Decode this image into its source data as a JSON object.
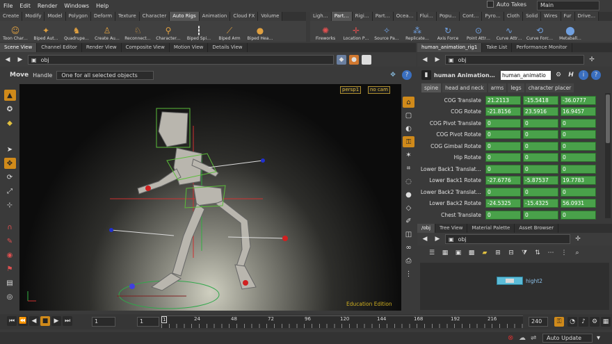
{
  "menu": [
    "File",
    "Edit",
    "Render",
    "Windows",
    "Help"
  ],
  "auto_takes": "Auto Takes",
  "take": "Main",
  "shelf_left_tabs": [
    "Create",
    "Modify",
    "Model",
    "Polygon",
    "Deform",
    "Texture",
    "Character",
    "Auto Rigs",
    "Animation",
    "Cloud FX",
    "Volume"
  ],
  "shelf_right_tabs": [
    "Ligh…",
    "Part…",
    "Rigi…",
    "Part…",
    "Ocea…",
    "Flui…",
    "Popu…",
    "Cont…",
    "Pyro…",
    "Cloth",
    "Solid",
    "Wires",
    "Fur",
    "Drive…"
  ],
  "shelf_left_tools": [
    "Toon Char…",
    "Biped Aut…",
    "Quadrupe…",
    "Create Au…",
    "Reconnect…",
    "Character…",
    "Biped Spi…",
    "Biped Arm",
    "Biped Hea…"
  ],
  "shelf_right_tools": [
    "Fireworks",
    "Location P…",
    "Source Pa…",
    "Replicate…",
    "Axis Force",
    "Point Attr…",
    "Curve Attr…",
    "Curve Forc…",
    "Metaball…"
  ],
  "left_tabs": [
    "Scene View",
    "Channel Editor",
    "Render View",
    "Composite View",
    "Motion View",
    "Details View"
  ],
  "right_tabs": [
    "human_animation_rig1",
    "Take List",
    "Performance Monitor"
  ],
  "path": "obj",
  "op": {
    "name": "Move",
    "handle": "Handle",
    "mode": "One for all selected objects"
  },
  "viewport": {
    "camera": "persp1",
    "cam_menu": "no cam",
    "watermark": "Education Edition"
  },
  "params": {
    "title": "human Animation…",
    "node": "human_animatio",
    "tabs": [
      "spine",
      "head and neck",
      "arms",
      "legs",
      "character placer"
    ],
    "rows": [
      {
        "label": "COG Translate",
        "v": [
          "21.2113",
          "-15.5418",
          "-36.0777"
        ]
      },
      {
        "label": "COG Rotate",
        "v": [
          "-21.8156",
          "23.5916",
          "16.9457"
        ]
      },
      {
        "label": "COG Pivot Translate",
        "v": [
          "0",
          "0",
          "0"
        ]
      },
      {
        "label": "COG Pivot Rotate",
        "v": [
          "0",
          "0",
          "0"
        ]
      },
      {
        "label": "COG Gimbal Rotate",
        "v": [
          "0",
          "0",
          "0"
        ]
      },
      {
        "label": "Hip Rotate",
        "v": [
          "0",
          "0",
          "0"
        ]
      },
      {
        "label": "Lower Back1 Translat…",
        "v": [
          "0",
          "0",
          "0"
        ]
      },
      {
        "label": "Lower Back1 Rotate",
        "v": [
          "-27.6776",
          "-5.87537",
          "19.7783"
        ]
      },
      {
        "label": "Lower Back2 Translat…",
        "v": [
          "0",
          "0",
          "0"
        ]
      },
      {
        "label": "Lower Back2 Rotate",
        "v": [
          "-24.5325",
          "-15.4325",
          "56.0931"
        ]
      },
      {
        "label": "Chest Translate",
        "v": [
          "0",
          "0",
          "0"
        ]
      }
    ]
  },
  "net": {
    "tabs": [
      "/obj",
      "Tree View",
      "Material Palette",
      "Asset Browser"
    ],
    "path": "obj",
    "node": "hight2"
  },
  "timeline": {
    "frame": "1",
    "start": "1",
    "end": "240",
    "ticks": [
      "1",
      "24",
      "48",
      "72",
      "96",
      "120",
      "144",
      "168",
      "192",
      "216"
    ]
  },
  "status": {
    "update": "Auto Update"
  },
  "colors": {
    "accent": "#d08a1a",
    "field": "#49a14a",
    "rig": "#5bbd3a"
  }
}
